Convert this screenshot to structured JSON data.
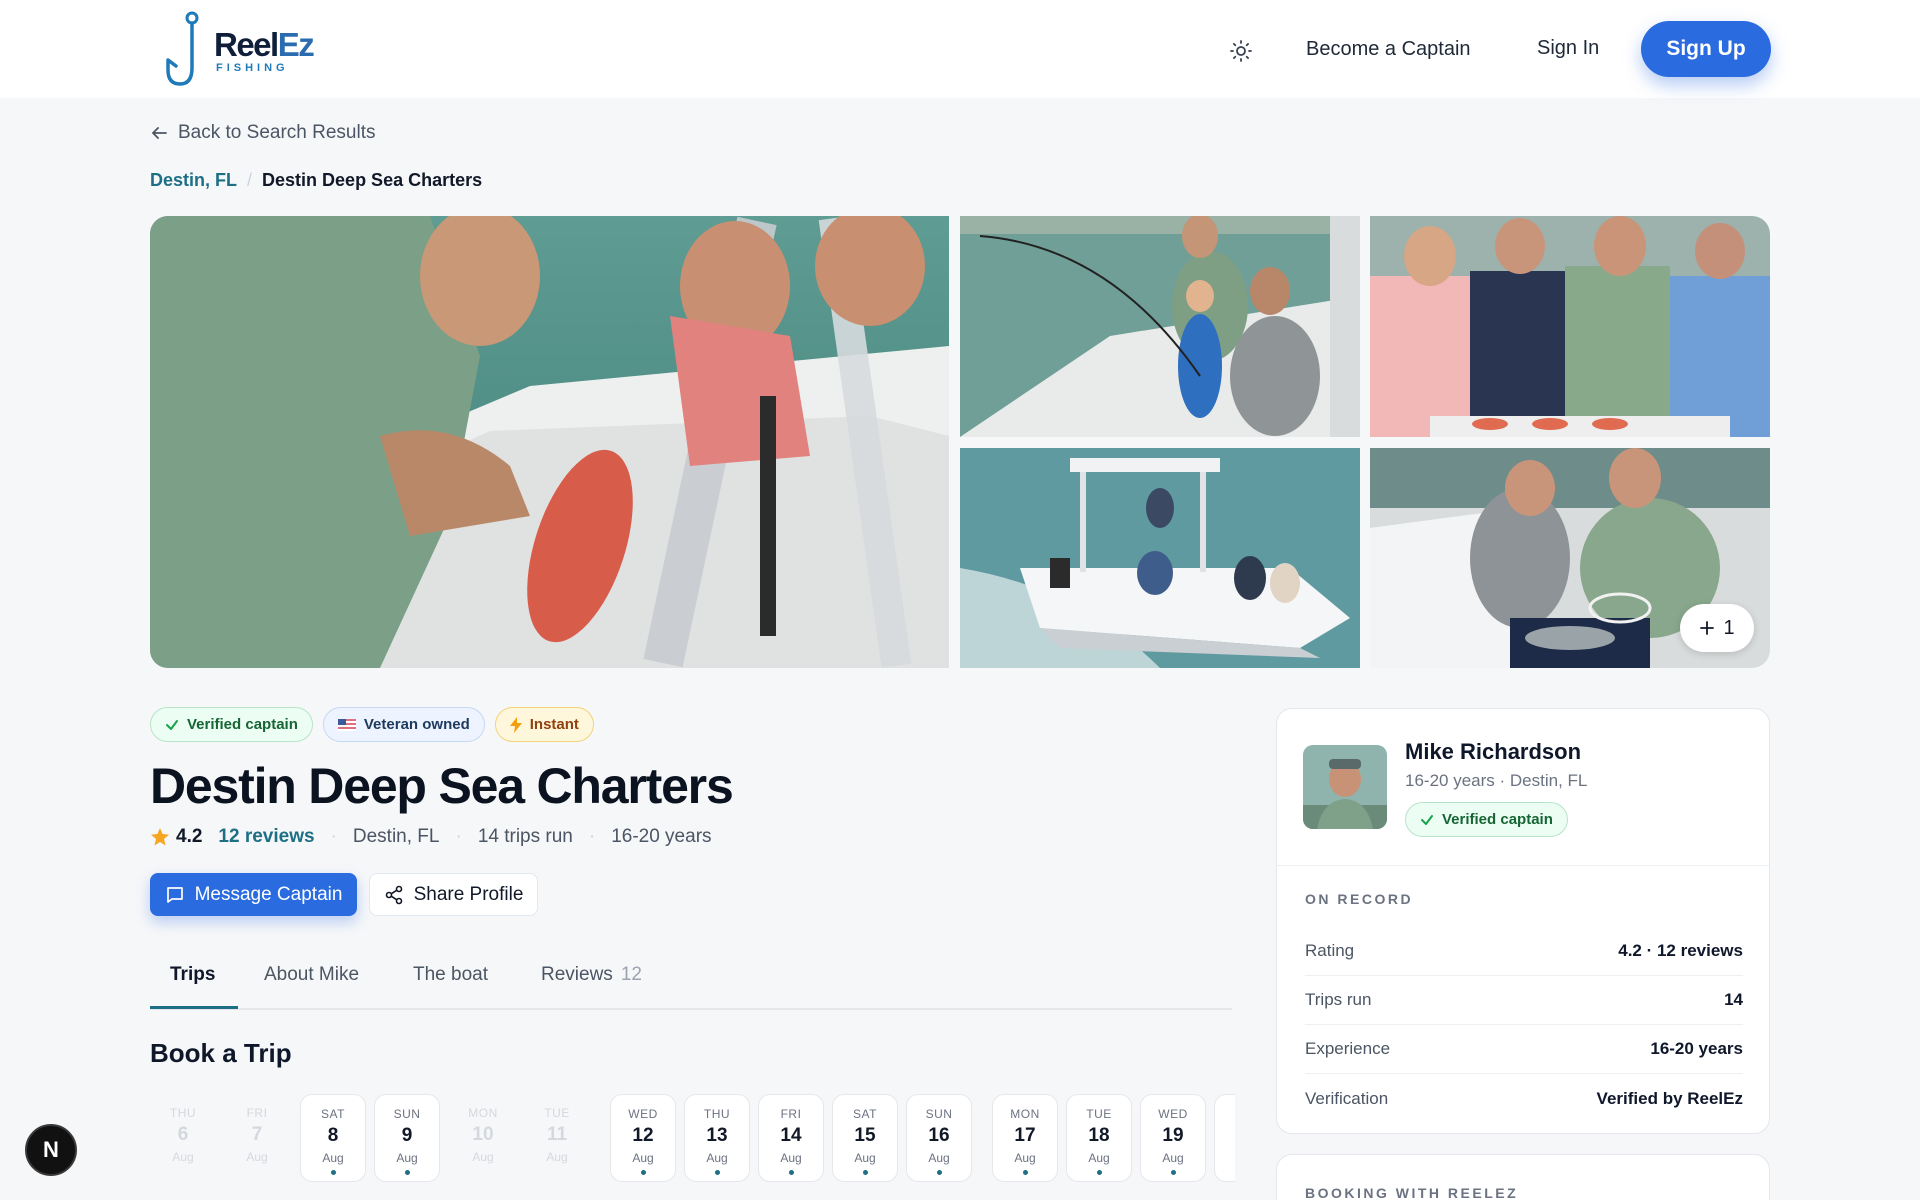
{
  "header": {
    "logo_word_1": "Reel",
    "logo_word_2": "Ez",
    "logo_sub": "FISHING",
    "theme_icon": "sun-icon",
    "become_captain": "Become a Captain",
    "sign_in": "Sign In",
    "sign_up": "Sign Up"
  },
  "nav": {
    "back_label": "Back to Search Results",
    "breadcrumb": [
      {
        "label": "Destin, FL"
      },
      {
        "label": "Destin Deep Sea Charters"
      }
    ]
  },
  "gallery": {
    "more_label": "1"
  },
  "listing": {
    "badges": [
      "Verified captain",
      "Veteran owned",
      "Instant"
    ],
    "title": "Destin Deep Sea Charters",
    "rating": "4.2",
    "reviews_label": "12 reviews",
    "location": "Destin, FL",
    "trips": "14 trips run",
    "experience": "16-20 years",
    "message_button": "Message Captain",
    "share_button": "Share Profile"
  },
  "tabs": [
    {
      "label": "Trips",
      "active": true
    },
    {
      "label": "About Mike"
    },
    {
      "label": "The boat"
    },
    {
      "label": "Reviews",
      "count": "12"
    }
  ],
  "booking": {
    "title": "Book a Trip",
    "dates": [
      {
        "dow": "THU",
        "num": "6",
        "mon": "Aug",
        "available": false
      },
      {
        "dow": "FRI",
        "num": "7",
        "mon": "Aug",
        "available": false
      },
      {
        "dow": "SAT",
        "num": "8",
        "mon": "Aug",
        "available": true
      },
      {
        "dow": "SUN",
        "num": "9",
        "mon": "Aug",
        "available": true
      },
      {
        "dow": "MON",
        "num": "10",
        "mon": "Aug",
        "available": false
      },
      {
        "dow": "TUE",
        "num": "11",
        "mon": "Aug",
        "available": false
      },
      {
        "dow": "WED",
        "num": "12",
        "mon": "Aug",
        "available": true
      },
      {
        "dow": "THU",
        "num": "13",
        "mon": "Aug",
        "available": true
      },
      {
        "dow": "FRI",
        "num": "14",
        "mon": "Aug",
        "available": true
      },
      {
        "dow": "SAT",
        "num": "15",
        "mon": "Aug",
        "available": true
      },
      {
        "dow": "SUN",
        "num": "16",
        "mon": "Aug",
        "available": true
      },
      {
        "dow": "MON",
        "num": "17",
        "mon": "Aug",
        "available": true
      },
      {
        "dow": "TUE",
        "num": "18",
        "mon": "Aug",
        "available": true
      },
      {
        "dow": "WED",
        "num": "19",
        "mon": "Aug",
        "available": true
      }
    ]
  },
  "captain": {
    "name": "Mike Richardson",
    "subtitle": "16-20 years · Destin, FL",
    "badge": "Verified captain",
    "on_record_title": "ON RECORD",
    "records": [
      {
        "key": "Rating",
        "value": "4.2 · 12 reviews"
      },
      {
        "key": "Trips run",
        "value": "14"
      },
      {
        "key": "Experience",
        "value": "16-20 years"
      },
      {
        "key": "Verification",
        "value": "Verified by ReelEz"
      }
    ],
    "booking_with": "BOOKING WITH REELEZ"
  },
  "fab": {
    "label": "N"
  },
  "colors": {
    "accent": "#2a6be0",
    "teal": "#1d6f86",
    "verified_green": "#166534"
  }
}
